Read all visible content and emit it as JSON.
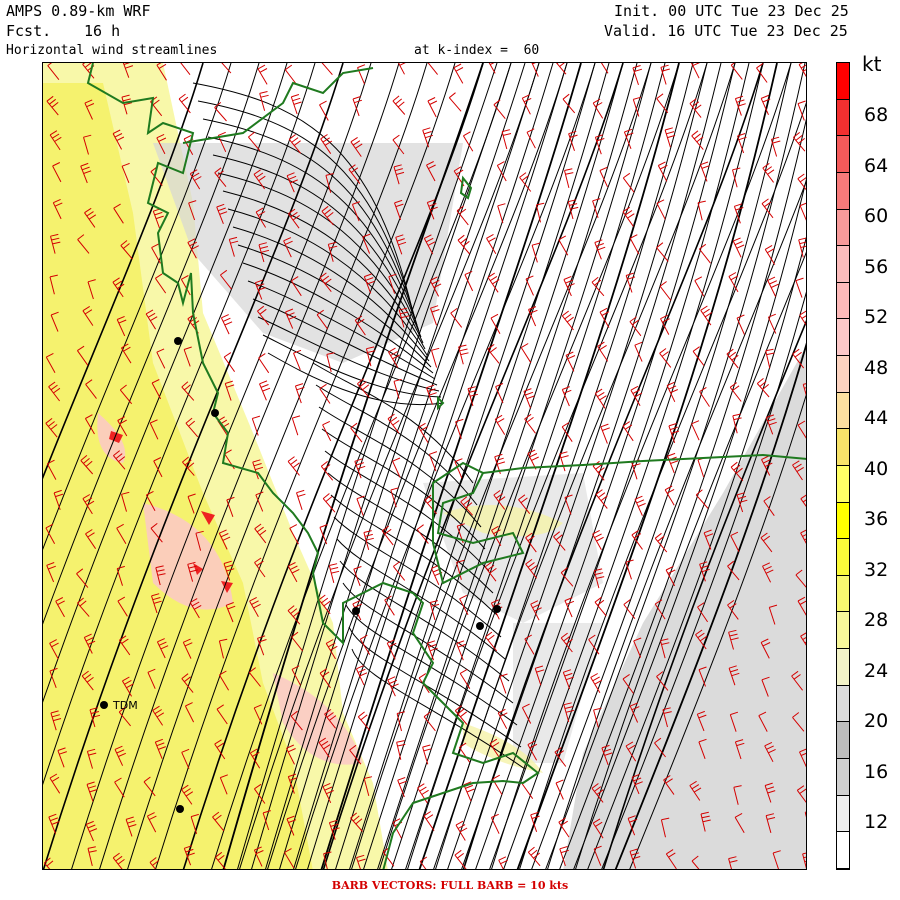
{
  "header": {
    "model": "AMPS 0.89-km WRF",
    "forecast_label": "Fcst.",
    "forecast_value": "16 h",
    "field": "Horizontal wind streamlines",
    "level": "at k-index =  60",
    "init": "Init. 00 UTC Tue 23 Dec 25",
    "valid": "Valid. 16 UTC Tue 23 Dec 25"
  },
  "colorbar": {
    "unit": "kt",
    "labels": [
      "12",
      "16",
      "20",
      "24",
      "28",
      "32",
      "36",
      "40",
      "44",
      "48",
      "52",
      "56",
      "60",
      "64",
      "68"
    ],
    "colors": [
      "#ffffff",
      "#eeeeee",
      "#d0d0d0",
      "#bdbdbd",
      "#dcdcdc",
      "#f3f3c8",
      "#f7f79a",
      "#f8f870",
      "#fbfb3a",
      "#ffff00",
      "#ffff66",
      "#f7e36a",
      "#fde0a0",
      "#fcd3c0",
      "#fcc8c8",
      "#fdb9b9",
      "#fbbcbc",
      "#f79a9a",
      "#f77a7a",
      "#f45a5a",
      "#f23030",
      "#ff0000"
    ]
  },
  "stations": [
    {
      "label": ""
    },
    {
      "label": ""
    },
    {
      "label": "TDM"
    },
    {
      "label": ""
    },
    {
      "label": ""
    },
    {
      "label": ""
    },
    {
      "label": ""
    }
  ],
  "footer": "BARB VECTORS:  FULL BARB = 10 kts"
}
